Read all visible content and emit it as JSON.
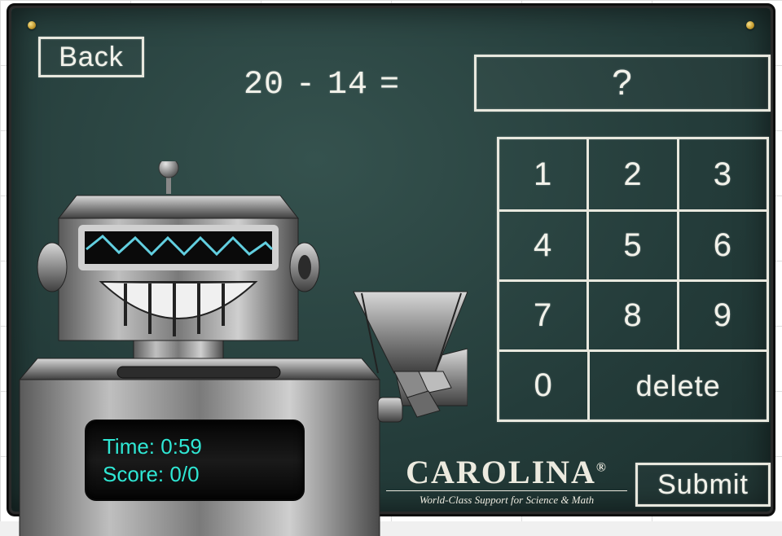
{
  "colors": {
    "chalk": "#f2f2ea",
    "board": "#243c3a",
    "lcd_text": "#2fe7d4"
  },
  "back_label": "Back",
  "equation": {
    "left": "20",
    "op": "-",
    "right": "14",
    "eq": "=",
    "answer_placeholder": "?"
  },
  "keypad": {
    "rows": [
      [
        "1",
        "2",
        "3"
      ],
      [
        "4",
        "5",
        "6"
      ],
      [
        "7",
        "8",
        "9"
      ]
    ],
    "zero": "0",
    "delete": "delete"
  },
  "submit_label": "Submit",
  "brand": {
    "name": "CAROLINA",
    "registered": "®",
    "tagline": "World-Class Support for Science & Math"
  },
  "status": {
    "time_label": "Time:",
    "time_value": "0:59",
    "score_label": "Score:",
    "score_value": "0/0"
  }
}
